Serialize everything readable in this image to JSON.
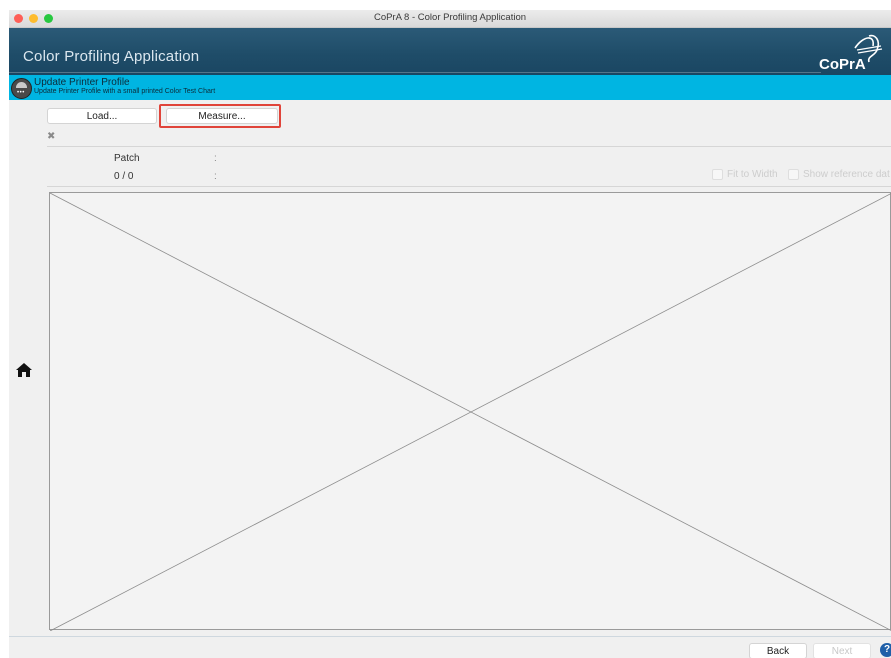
{
  "window": {
    "title": "CoPrA 8 - Color Profiling Application"
  },
  "banner": {
    "title": "Color Profiling Application",
    "logo_text": "CoPrA"
  },
  "subheader": {
    "title": "Update Printer Profile",
    "description": "Update Printer Profile with a small printed Color Test Chart",
    "icon": "printer-icon"
  },
  "toolbar": {
    "load_label": "Load...",
    "measure_label": "Measure...",
    "close_icon": "close-icon"
  },
  "patch": {
    "label": "Patch",
    "value": "0 / 0",
    "sep1": ":",
    "sep2": ":"
  },
  "options": {
    "fit_to_width": "Fit to Width",
    "show_reference": "Show reference dat"
  },
  "nav": {
    "back_label": "Back",
    "next_label": "Next",
    "help_label": "?",
    "home_icon": "home-icon"
  },
  "colors": {
    "accent": "#00b5e2",
    "banner": "#1f4d69",
    "highlight": "#e0443a"
  }
}
